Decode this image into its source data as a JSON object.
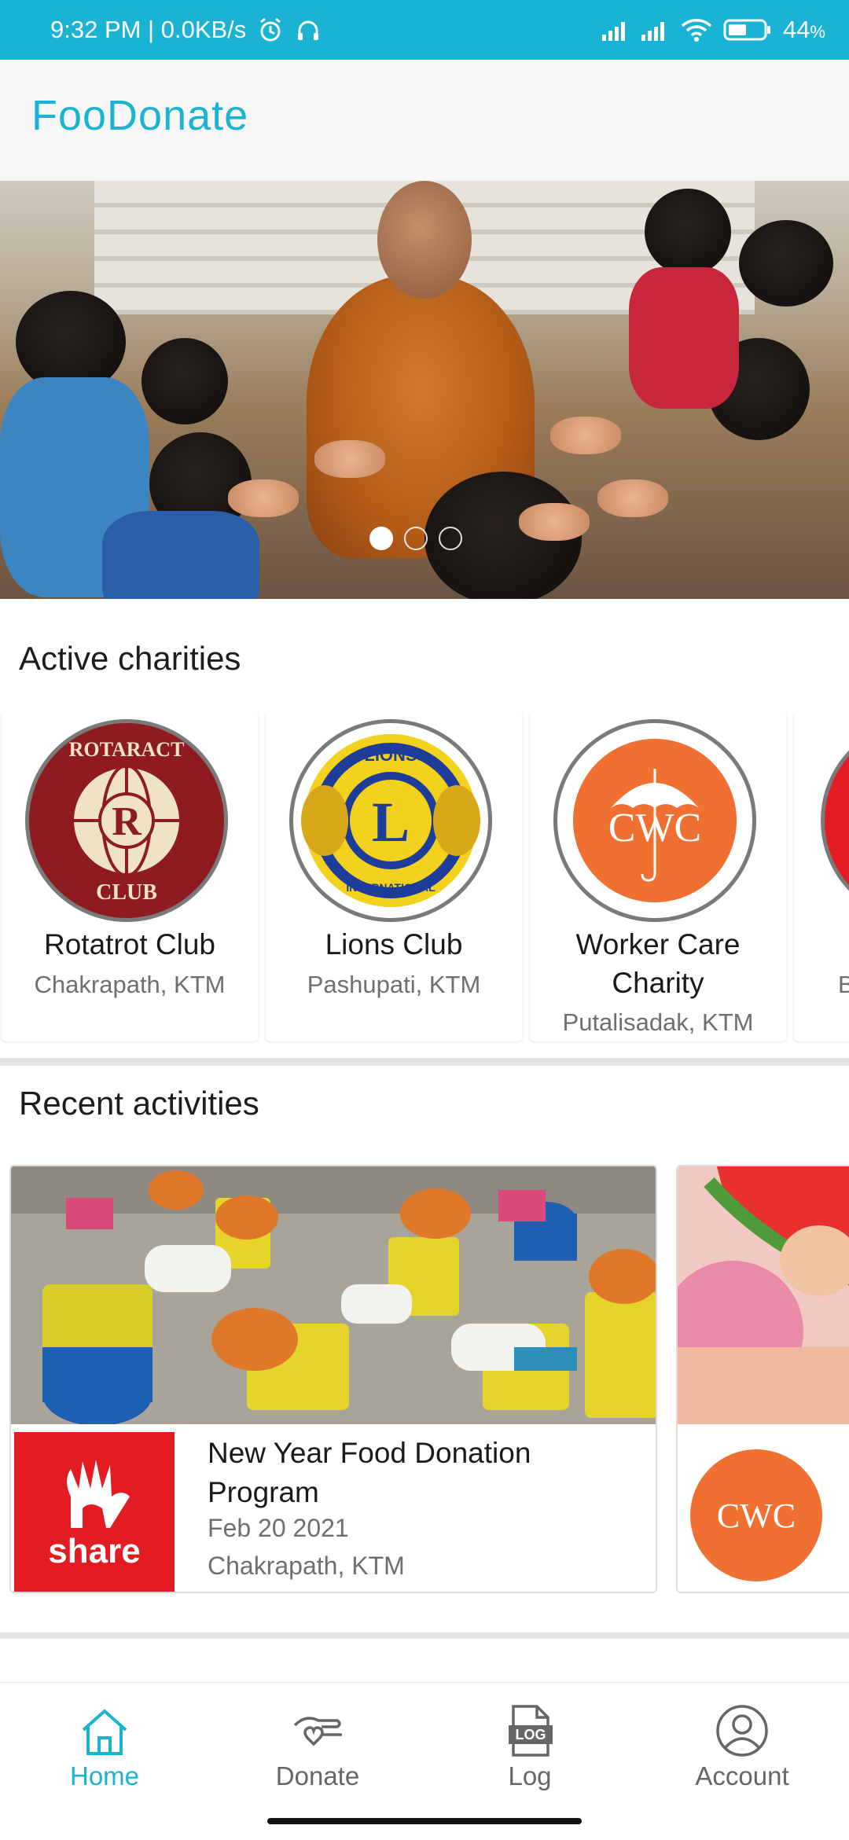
{
  "status_bar": {
    "time_speed": "9:32 PM | 0.0KB/s",
    "battery_level": "44",
    "battery_unit": "%"
  },
  "app_bar": {
    "title": "FooDonate"
  },
  "carousel": {
    "slide_count": 3,
    "active_index": 0
  },
  "charities": {
    "heading": "Active charities",
    "items": [
      {
        "name": "Rotatrot Club",
        "location": "Chakrapath, KTM",
        "logo": "rotaract-logo",
        "logo_text": "ROTARACT CLUB"
      },
      {
        "name": "Lions Club",
        "location": "Pashupati, KTM",
        "logo": "lions-logo",
        "logo_text": "LIONS INTERNATIONAL"
      },
      {
        "name": "Worker Care Charity",
        "location": "Putalisadak, KTM",
        "logo": "cwc-logo",
        "logo_text": "CWC"
      }
    ],
    "partial_location": "B"
  },
  "activities": {
    "heading": "Recent activities",
    "items": [
      {
        "title": "New Year Food Donation Program",
        "date": "Feb 20 2021",
        "location": "Chakrapath, KTM",
        "logo_text": "share"
      }
    ],
    "partial_logo_text": "CWC"
  },
  "bottom_nav": {
    "items": [
      {
        "label": "Home",
        "icon": "home-icon",
        "active": true
      },
      {
        "label": "Donate",
        "icon": "donate-hand-heart-icon",
        "active": false
      },
      {
        "label": "Log",
        "icon": "log-file-icon",
        "active": false
      },
      {
        "label": "Account",
        "icon": "account-user-icon",
        "active": false
      }
    ],
    "log_icon_text": "LOG"
  },
  "colors": {
    "accent": "#1ab3d4",
    "cwc_orange": "#ef7030",
    "share_red": "#e31b23",
    "rotaract_red": "#8e1b1f",
    "lions_blue": "#1e3c9a",
    "lions_yellow": "#f2d21c"
  }
}
